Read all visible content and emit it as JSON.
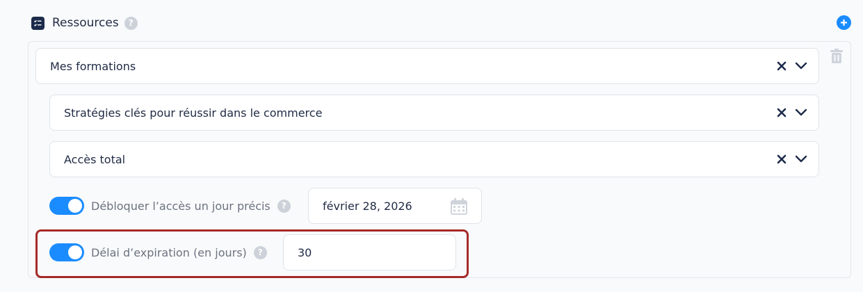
{
  "header": {
    "title": "Ressources",
    "help": "?",
    "icon": "checklist-icon",
    "add_icon": "plus-circle-icon"
  },
  "resource": {
    "category": "Mes formations",
    "course": "Stratégies clés pour réussir dans le commerce",
    "access": "Accès total"
  },
  "unlock": {
    "label": "Débloquer l’accès un jour précis",
    "help": "?",
    "enabled": true,
    "date": "février 28, 2026",
    "date_icon": "calendar-icon"
  },
  "expiration": {
    "label": "Délai d’expiration (en jours)",
    "help": "?",
    "enabled": true,
    "value": "30"
  },
  "colors": {
    "accent": "#1a8cff",
    "highlight": "#a52a2a",
    "text": "#1f2a44",
    "muted": "#6b7380"
  }
}
